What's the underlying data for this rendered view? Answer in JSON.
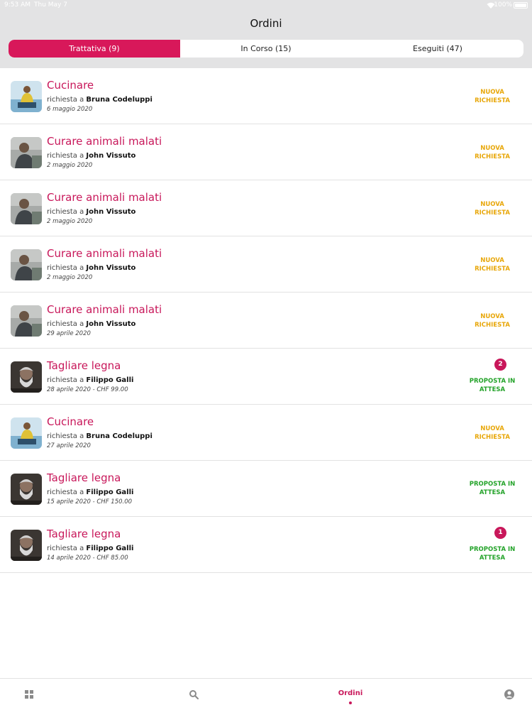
{
  "status_bar": {
    "time": "9:53 AM",
    "date": "Thu May 7",
    "battery": "100%"
  },
  "nav": {
    "title": "Ordini"
  },
  "segments": [
    {
      "label": "Trattativa (9)",
      "active": true
    },
    {
      "label": "In Corso (15)",
      "active": false
    },
    {
      "label": "Eseguiti (47)",
      "active": false
    }
  ],
  "orders": [
    {
      "title": "Cucinare",
      "prefix": "richiesta a",
      "name": "Bruna Codeluppi",
      "meta": "6 maggio 2020",
      "status": "NUOVA RICHIESTA",
      "status_type": "new",
      "avatar": "woman"
    },
    {
      "title": "Curare animali malati",
      "prefix": "richiesta a",
      "name": "John Vissuto",
      "meta": "2 maggio 2020",
      "status": "NUOVA RICHIESTA",
      "status_type": "new",
      "avatar": "man-grey"
    },
    {
      "title": "Curare animali malati",
      "prefix": "richiesta a",
      "name": "John Vissuto",
      "meta": "2 maggio 2020",
      "status": "NUOVA RICHIESTA",
      "status_type": "new",
      "avatar": "man-grey"
    },
    {
      "title": "Curare animali malati",
      "prefix": "richiesta a",
      "name": "John Vissuto",
      "meta": "2 maggio 2020",
      "status": "NUOVA RICHIESTA",
      "status_type": "new",
      "avatar": "man-grey"
    },
    {
      "title": "Curare animali malati",
      "prefix": "richiesta a",
      "name": "John Vissuto",
      "meta": "29 aprile 2020",
      "status": "NUOVA RICHIESTA",
      "status_type": "new",
      "avatar": "man-grey"
    },
    {
      "title": "Tagliare legna",
      "prefix": "richiesta a",
      "name": "Filippo Galli",
      "meta": "28 aprile 2020 - CHF 99.00",
      "status": "PROPOSTA IN ATTESA",
      "status_type": "pending",
      "badge": "2",
      "avatar": "bearded"
    },
    {
      "title": "Cucinare",
      "prefix": "richiesta a",
      "name": "Bruna Codeluppi",
      "meta": "27 aprile 2020",
      "status": "NUOVA RICHIESTA",
      "status_type": "new",
      "avatar": "woman"
    },
    {
      "title": "Tagliare legna",
      "prefix": "richiesta a",
      "name": "Filippo Galli",
      "meta": "15 aprile 2020 - CHF 150.00",
      "status": "PROPOSTA IN ATTESA",
      "status_type": "pending",
      "avatar": "bearded"
    },
    {
      "title": "Tagliare legna",
      "prefix": "richiesta a",
      "name": "Filippo Galli",
      "meta": "14 aprile 2020 - CHF 85.00",
      "status": "PROPOSTA IN ATTESA",
      "status_type": "pending",
      "badge": "1",
      "avatar": "bearded"
    }
  ],
  "tabbar": {
    "items": [
      {
        "icon": "grid-icon"
      },
      {
        "icon": "search-icon"
      },
      {
        "label": "Ordini",
        "active": true
      },
      {
        "icon": "profile-icon"
      }
    ]
  },
  "colors": {
    "accent": "#c8175a",
    "segment_active": "#d8185a",
    "new_status": "#e8a70a",
    "pending_status": "#24a32a"
  }
}
